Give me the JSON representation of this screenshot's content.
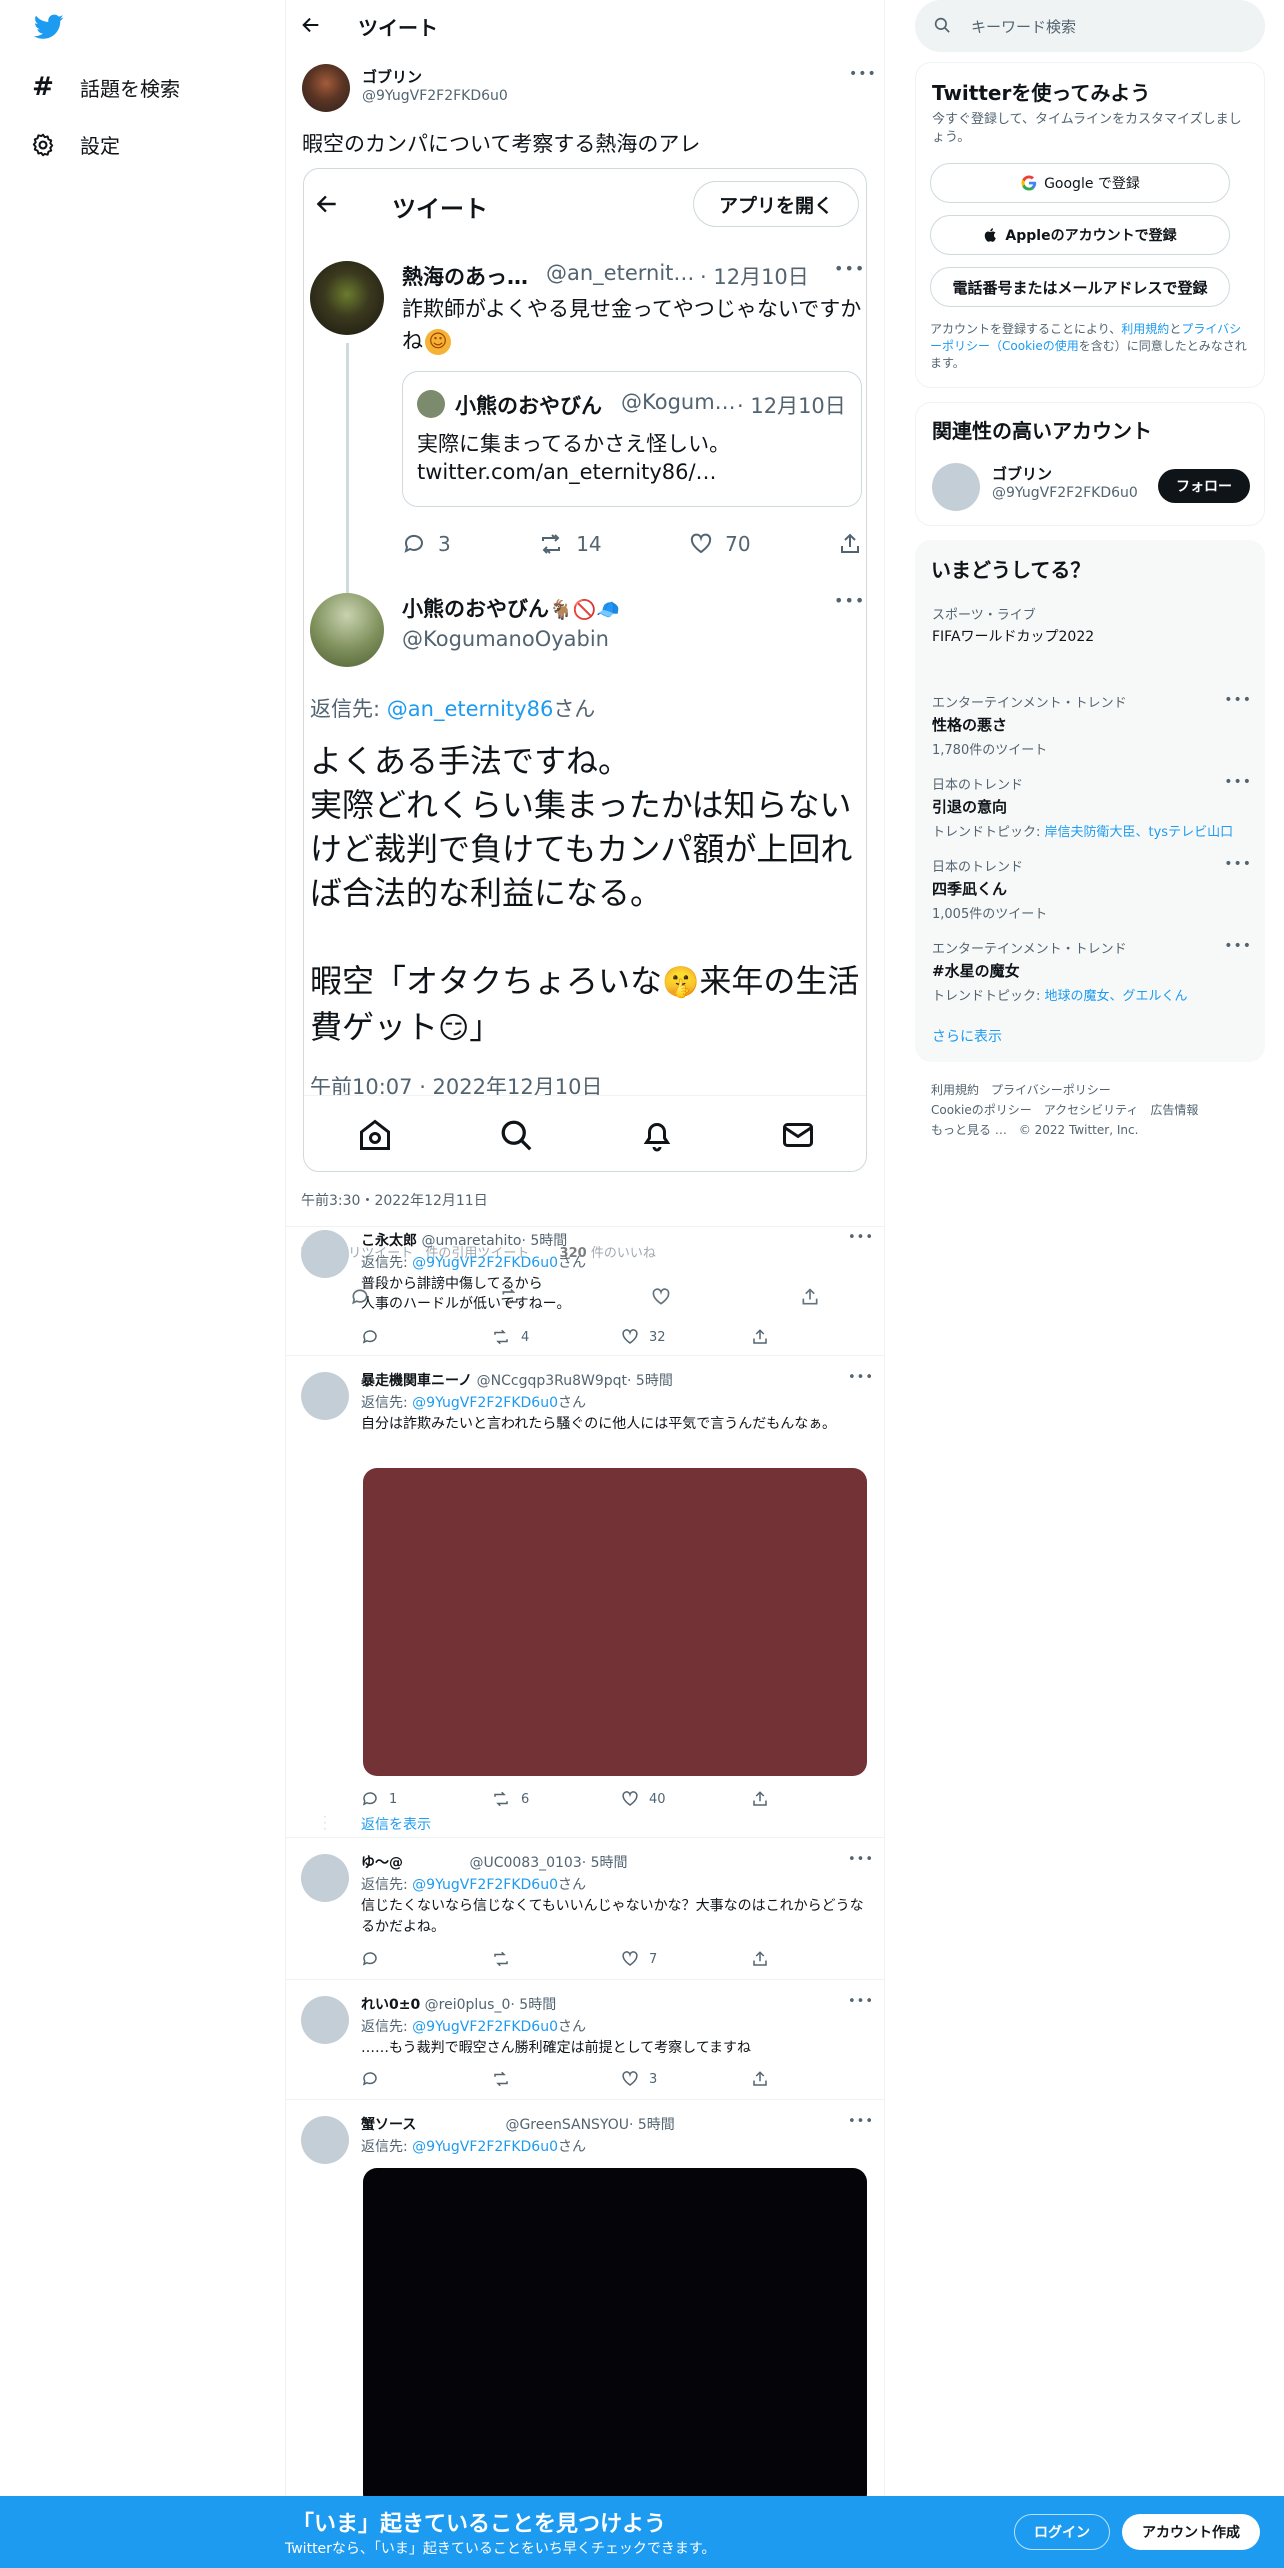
{
  "nav": {
    "explore_label": "話題を検索",
    "settings_label": "設定"
  },
  "header": {
    "title": "ツイート"
  },
  "tweet": {
    "name": "ゴブリン",
    "handle": "@9YugVF2F2FKD6u0",
    "text": "暇空のカンパについて考察する熱海のアレ",
    "timestamp": "午前3:30・2022年12月11日",
    "retweet_count": "16",
    "retweet_label": "件のリツイート",
    "quote_label": "件の引用ツイート",
    "like_count": "320",
    "like_label": "件のいいね"
  },
  "embed": {
    "header_title": "ツイート",
    "open_app_label": "アプリを開く",
    "t1": {
      "name": "熱海のあっ…",
      "handle": "@an_eternit…",
      "date": "· 12月10日",
      "text": "詐欺師がよくやる見せ金ってやつじゃないですかね",
      "emoji": "☺",
      "reply_count": "3",
      "retweet_count": "14",
      "like_count": "70"
    },
    "quote": {
      "name": "小熊のおやびん",
      "handle": "@Kogum…",
      "date": "· 12月10日",
      "text": "実際に集まってるかさえ怪しい。",
      "link": "twitter.com/an_eternity86/…"
    },
    "t2": {
      "name": "小熊のおやびん",
      "name_emoji": "🐐🚫🧢",
      "handle": "@KogumanoOyabin",
      "reply_prefix": "返信先:",
      "reply_target": "@an_eternity86",
      "reply_suffix": "さん",
      "text1": "よくある手法ですね。",
      "text2": "実際どれくらい集まったかは知らないけど裁判で負けてもカンパ額が上回れば合法的な利益になる。",
      "text3": "暇空「オタクちょろいな",
      "text3_emoji": "🤫",
      "text3b": "来年の生活費ゲット",
      "text3_emoji2": "😏",
      "text3c": "」",
      "timestamp": "午前10:07 · 2022年12月10日"
    }
  },
  "replies": [
    {
      "name": "こ永太郎",
      "handle": "@umaretahito",
      "time": "· 5時間",
      "reply_prefix": "返信先:",
      "reply_target": "@9YugVF2F2FKD6u0",
      "reply_suffix": "さん",
      "text": "普段から誹謗中傷してるから\n人事のハードルが低いですねー。",
      "reply_count": "",
      "retweet_count": "4",
      "like_count": "32"
    },
    {
      "name": "暴走機関車ニーノ",
      "handle": "@NCcgqp3Ru8W9pqt",
      "time": "· 5時間",
      "reply_prefix": "返信先:",
      "reply_target": "@9YugVF2F2FKD6u0",
      "reply_suffix": "さん",
      "text": "自分は詐欺みたいと言われたら騒ぐのに他人には平気で言うんだもんなぁ。",
      "reply_count": "1",
      "retweet_count": "6",
      "like_count": "40",
      "show_replies": "返信を表示",
      "media_color": "#733336"
    },
    {
      "name": "ゆ〜@",
      "handle": "@UC0083_0103",
      "time": "· 5時間",
      "reply_prefix": "返信先:",
      "reply_target": "@9YugVF2F2FKD6u0",
      "reply_suffix": "さん",
      "text": "信じたくないなら信じなくてもいいんじゃないかな？大事なのはこれからどうなるかだよね。",
      "reply_count": "",
      "retweet_count": "",
      "like_count": "7"
    },
    {
      "name": "れい0±0",
      "handle": "@rei0plus_0",
      "time": "· 5時間",
      "reply_prefix": "返信先:",
      "reply_target": "@9YugVF2F2FKD6u0",
      "reply_suffix": "さん",
      "text": "……もう裁判で暇空さん勝利確定は前提として考察してますね",
      "reply_count": "",
      "retweet_count": "",
      "like_count": "3"
    },
    {
      "name": "蟹ソース",
      "handle": "@GreenSANSYOU",
      "time": "· 5時間",
      "reply_prefix": "返信先:",
      "reply_target": "@9YugVF2F2FKD6u0",
      "reply_suffix": "さん",
      "media_color": "#050408"
    }
  ],
  "sidebar": {
    "search_placeholder": "キーワード検索",
    "signup_title": "Twitterを使ってみよう",
    "signup_sub": "今すぐ登録して、タイムラインをカスタマイズしましょう。",
    "google_label": "Google で登録",
    "apple_label": "Appleのアカウントで登録",
    "phone_label": "電話番号またはメールアドレスで登録",
    "terms_1": "アカウントを登録することにより、",
    "terms_link1": "利用規約",
    "terms_2": "と",
    "terms_link2": "プライバシーポリシー（Cookieの使用",
    "terms_3": "を含む）に同意したとみなされます。",
    "related_title": "関連性の高いアカウント",
    "related_name": "ゴブリン",
    "related_handle": "@9YugVF2F2FKD6u0",
    "follow_label": "フォロー",
    "trends_title": "いまどうしてる？",
    "trends": [
      {
        "category": "スポーツ・ライブ",
        "name": "FIFAワールドカップ2022",
        "count": ""
      },
      {
        "category": "エンターテインメント・トレンド",
        "name": "性格の悪さ",
        "count": "1,780件のツイート"
      },
      {
        "category": "日本のトレンド",
        "name": "引退の意向",
        "count_prefix": "トレンドトピック: ",
        "count_link": "岸信夫防衛大臣、tysテレビ山口"
      },
      {
        "category": "日本のトレンド",
        "name": "四季凪くん",
        "count": "1,005件のツイート"
      },
      {
        "category": "エンターテインメント・トレンド",
        "name": "#水星の魔女",
        "count_prefix": "トレンドトピック: ",
        "count_link": "地球の魔女、グエルくん"
      }
    ],
    "show_more": "さらに表示",
    "footer_line1": "利用規約　プライバシーポリシー",
    "footer_line2": "Cookieのポリシー　アクセシビリティ　広告情報",
    "footer_line3": "もっと見る …　© 2022 Twitter, Inc."
  },
  "bottom": {
    "title": "「いま」起きていることを見つけよう",
    "subtitle": "Twitterなら、「いま」起きていることをいち早くチェックできます。",
    "login_label": "ログイン",
    "signup_label": "アカウント作成"
  },
  "colors": {
    "brand": "#1d9bf0",
    "text": "#0f1419",
    "muted": "#536471"
  }
}
